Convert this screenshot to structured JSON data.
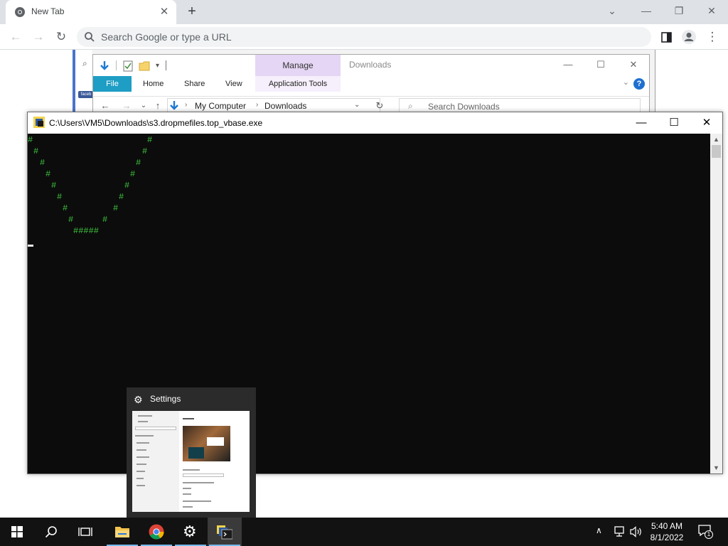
{
  "browser": {
    "tab_title": "New Tab",
    "tab_close": "✕",
    "new_tab": "+",
    "omnibox_placeholder": "Search Google or type a URL",
    "window_controls": {
      "dropdown": "⌄",
      "minimize": "—",
      "restore": "❐",
      "close": "✕"
    }
  },
  "explorer": {
    "context_tab": "Manage",
    "title": "Downloads",
    "ribbon_tabs": [
      "File",
      "Home",
      "Share",
      "View",
      "Application Tools"
    ],
    "breadcrumb": [
      "My Computer",
      "Downloads"
    ],
    "search_placeholder": "Search Downloads",
    "help": "?",
    "sidebar_badge": "faceb"
  },
  "console": {
    "title": "C:\\Users\\VM5\\Downloads\\s3.dropmefiles.top_vbase.exe",
    "controls": {
      "minimize": "—",
      "maximize": "☐",
      "close": "✕"
    },
    "lines": {
      "l1a": "#",
      "l1b": "#",
      "l2a": "#",
      "l2b": "#",
      "l3a": "#",
      "l3b": "#",
      "l4a": "#",
      "l4b": "#",
      "l5a": "#",
      "l5b": "#",
      "l6a": "#",
      "l6b": "#",
      "l7a": "#",
      "l7b": "#",
      "l8a": "#",
      "l8b": "#",
      "l9": "#####"
    }
  },
  "settings_preview": {
    "title": "Settings",
    "icon": "gear-icon"
  },
  "taskbar": {
    "items": [
      "start-icon",
      "search-icon",
      "task-view-icon",
      "file-explorer-icon",
      "chrome-icon",
      "settings-icon",
      "python-console-icon"
    ],
    "time": "5:40 AM",
    "date": "8/1/2022",
    "notification_count": "1",
    "tray_chevron": "∧"
  },
  "colors": {
    "console_text": "#3ec43e",
    "file_tab": "#1e9ec5",
    "manage_tab": "#e5d6f5",
    "taskbar": "#121212",
    "accent_run": "#76b9ed"
  }
}
